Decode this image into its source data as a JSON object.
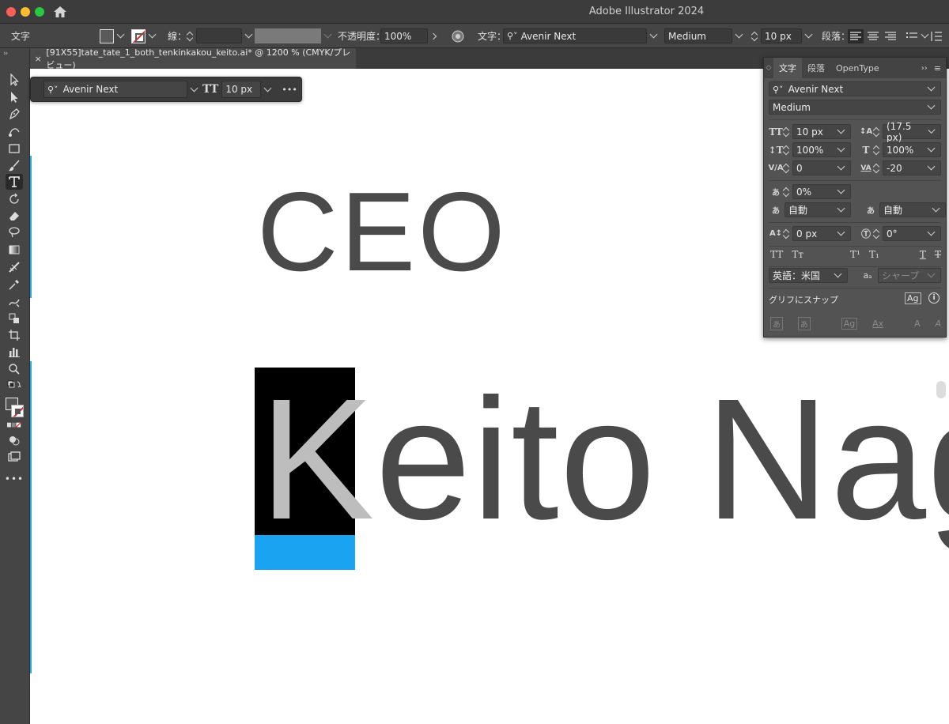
{
  "app": {
    "title": "Adobe Illustrator 2024"
  },
  "controlbar": {
    "mode_label": "文字",
    "stroke_label": "線：",
    "opacity_label": "不透明度：",
    "opacity_value": "100%",
    "char_label": "文字：",
    "font_family": "Avenir Next",
    "font_style": "Medium",
    "font_size": "10 px",
    "paragraph_label": "段落："
  },
  "tab": {
    "close": "×",
    "title": "[91X55]tate_tate_1_both_tenkinkakou_keito.ai* @ 1200 % (CMYK/プレビュー)"
  },
  "floatbar": {
    "font_family": "Avenir Next",
    "font_size": "10 px",
    "more": "•••"
  },
  "canvas": {
    "title_text": "CEO",
    "name_first": "K",
    "name_rest": "eito Nag"
  },
  "panel": {
    "tabs": [
      "文字",
      "段落",
      "OpenType"
    ],
    "font_family": "Avenir Next",
    "font_style": "Medium",
    "font_size": "10 px",
    "leading": "(17.5 px)",
    "vertical_scale": "100%",
    "horizontal_scale": "100%",
    "kerning": "0",
    "tracking": "-20",
    "tsume": "0%",
    "aki_left": "自動",
    "aki_right": "自動",
    "baseline_shift": "0 px",
    "rotation": "0°",
    "language": "英語：米国",
    "antialias": "シャープ",
    "snap_label": "グリフにスナップ"
  },
  "colors": {
    "accent_blue": "#1aa3f0",
    "canvas": "#ffffff",
    "ui_dark": "#535353",
    "text_gray": "#4a4a4a"
  }
}
